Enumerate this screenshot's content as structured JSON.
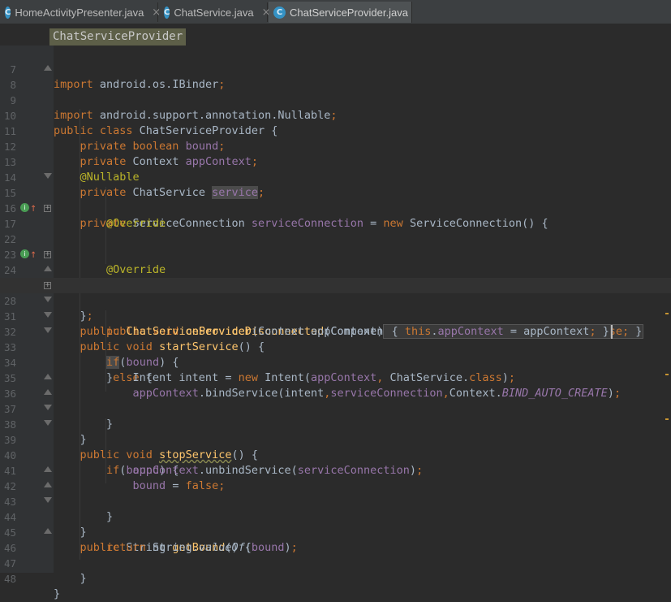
{
  "tabs": [
    {
      "label": "HomeActivityPresenter.java",
      "icon": "class-c-icon",
      "active": false
    },
    {
      "label": "ChatService.java",
      "icon": "class-c-icon",
      "active": false
    },
    {
      "label": "ChatServiceProvider.java",
      "icon": "class-c-icon",
      "active": true
    }
  ],
  "tab_icon_letter": "C",
  "tab_close_glyph": "×",
  "breadcrumb": "ChatServiceProvider",
  "fold_placeholder": "{...}",
  "line_numbers": [
    "7",
    "8",
    "9",
    "10",
    "11",
    "12",
    "13",
    "14",
    "15",
    "16",
    "17",
    "22",
    "23",
    "24",
    "27",
    "28",
    "31",
    "32",
    "33",
    "34",
    "35",
    "36",
    "37",
    "38",
    "39",
    "40",
    "41",
    "42",
    "43",
    "44",
    "45",
    "46",
    "47",
    "48"
  ],
  "colors": {
    "editor_bg": "#2b2b2b",
    "gutter_bg": "#313335",
    "keyword": "#cc7832",
    "field": "#9876aa",
    "method": "#ffc66d",
    "annotation": "#bbb529",
    "default_text": "#a9b7c6"
  }
}
